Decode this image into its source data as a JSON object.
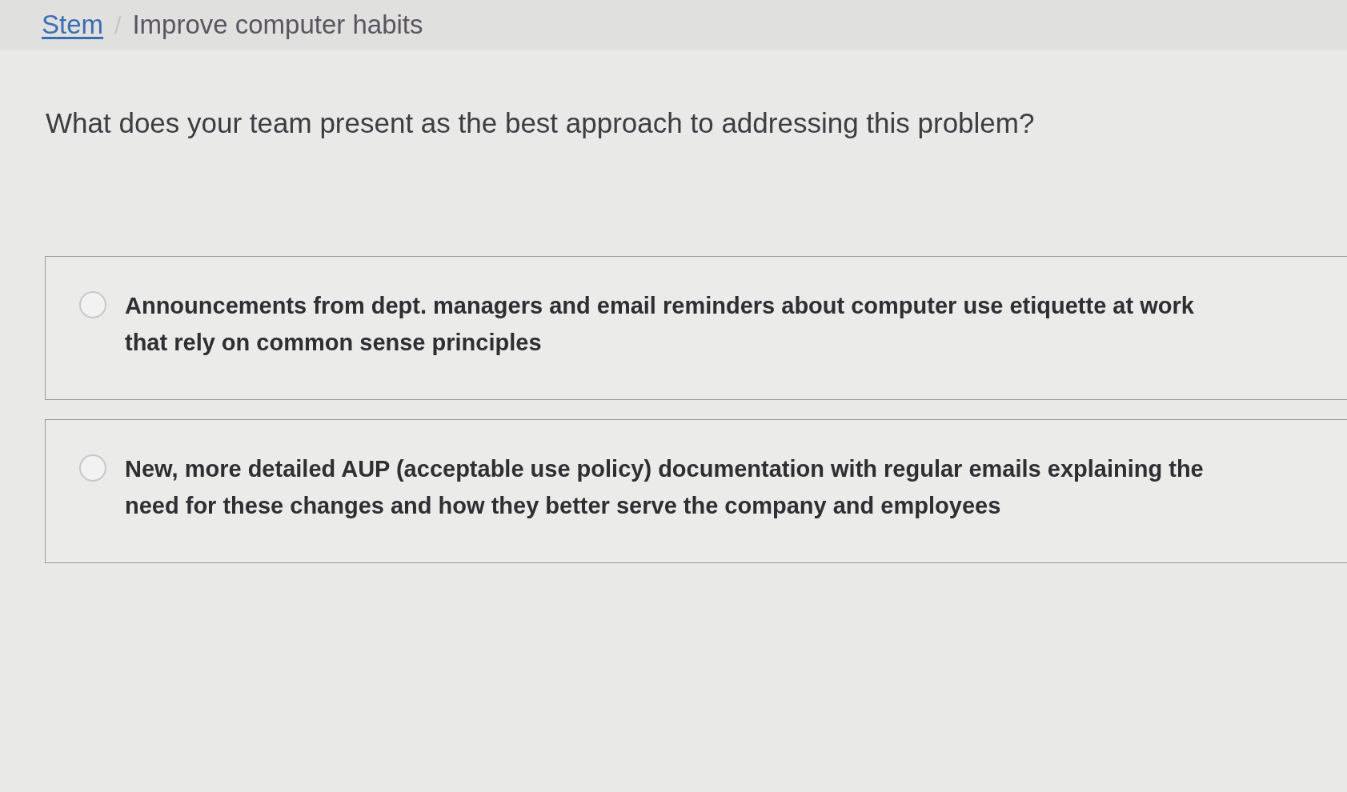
{
  "breadcrumb": {
    "items": [
      {
        "label": "Stem",
        "kind": "link"
      },
      {
        "label": "Improve computer habits",
        "kind": "current"
      }
    ],
    "separator": "/"
  },
  "question": "What does your team present as the best approach to addressing this problem?",
  "options": [
    {
      "label": "Announcements from dept. managers and email reminders about computer use etiquette at work that rely on common sense principles",
      "selected": false
    },
    {
      "label": "New, more detailed AUP (acceptable use policy) documentation with regular emails explaining the need for these changes and how they better serve the company and employees",
      "selected": false
    }
  ]
}
